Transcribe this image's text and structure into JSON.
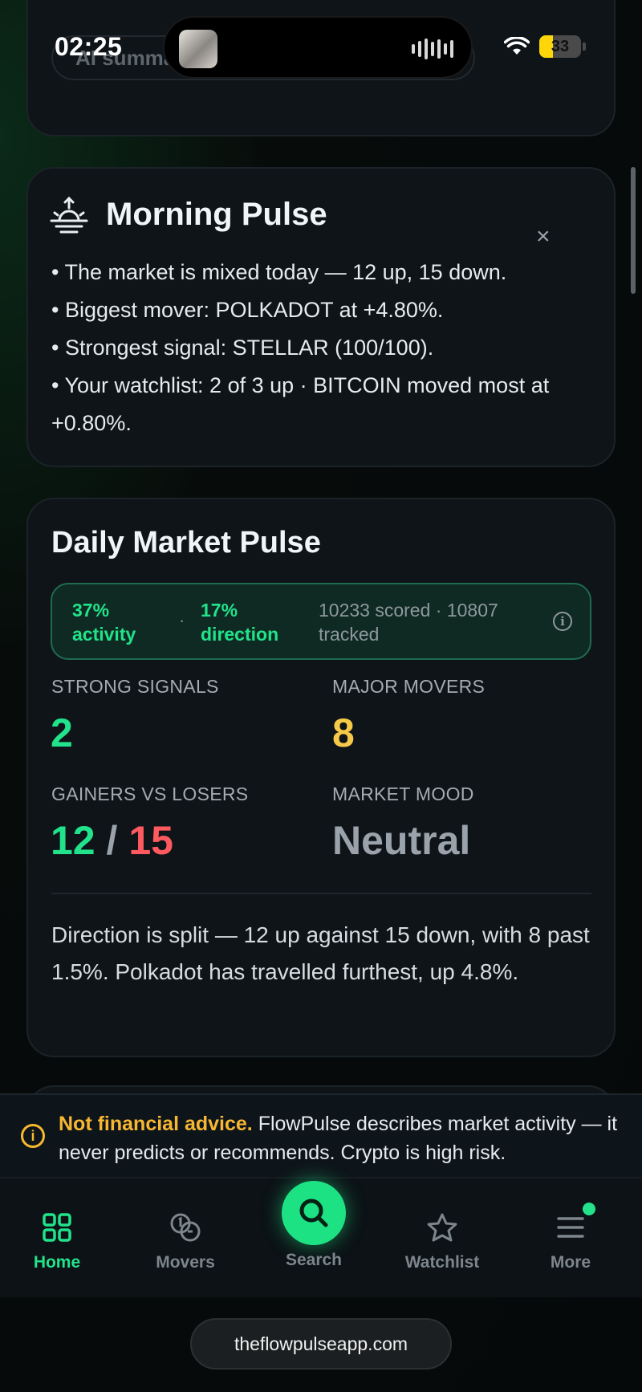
{
  "status_bar": {
    "time": "02:25",
    "battery": "33",
    "battery_level": 0.33
  },
  "ai_summary": {
    "label": "AI summa"
  },
  "morning_pulse": {
    "title": "Morning Pulse",
    "close_label": "×",
    "bullets": [
      "• The market is mixed today — 12 up, 15 down.",
      "• Biggest mover: POLKADOT at +4.80%.",
      "• Strongest signal: STELLAR (100/100).",
      "• Your watchlist: 2 of 3 up · BITCOIN moved most at +0.80%."
    ]
  },
  "daily_market_pulse": {
    "title": "Daily Market Pulse",
    "activity": {
      "pct": "37%",
      "label": "activity"
    },
    "direction": {
      "pct": "17%",
      "label": "direction"
    },
    "separator": "·",
    "meta": "10233 scored · 10807 tracked",
    "info_icon": "i",
    "strong_signals": {
      "label": "STRONG SIGNALS",
      "value": "2"
    },
    "major_movers": {
      "label": "MAJOR MOVERS",
      "value": "8"
    },
    "gainers_vs_losers": {
      "label": "GAINERS VS LOSERS",
      "gainers": "12",
      "sep": "/",
      "losers": "15"
    },
    "market_mood": {
      "label": "MARKET MOOD",
      "value": "Neutral"
    },
    "summary": "Direction is split — 12 up against 15 down, with 8 past 1.5%. Polkadot has travelled furthest, up 4.8%."
  },
  "disclaimer": {
    "bold": "Not financial advice.",
    "text": " FlowPulse describes market activity — it never predicts or recommends. Crypto is high risk."
  },
  "nav": {
    "home": "Home",
    "movers": "Movers",
    "search": "Search",
    "watchlist": "Watchlist",
    "more": "More"
  },
  "url": "theflowpulseapp.com",
  "colors": {
    "accent": "#1de283",
    "gain": "#22e38b",
    "loss": "#ff5a5f",
    "warning": "#f7b731",
    "movers": "#f7c948",
    "neutral": "#9aa3ab"
  }
}
